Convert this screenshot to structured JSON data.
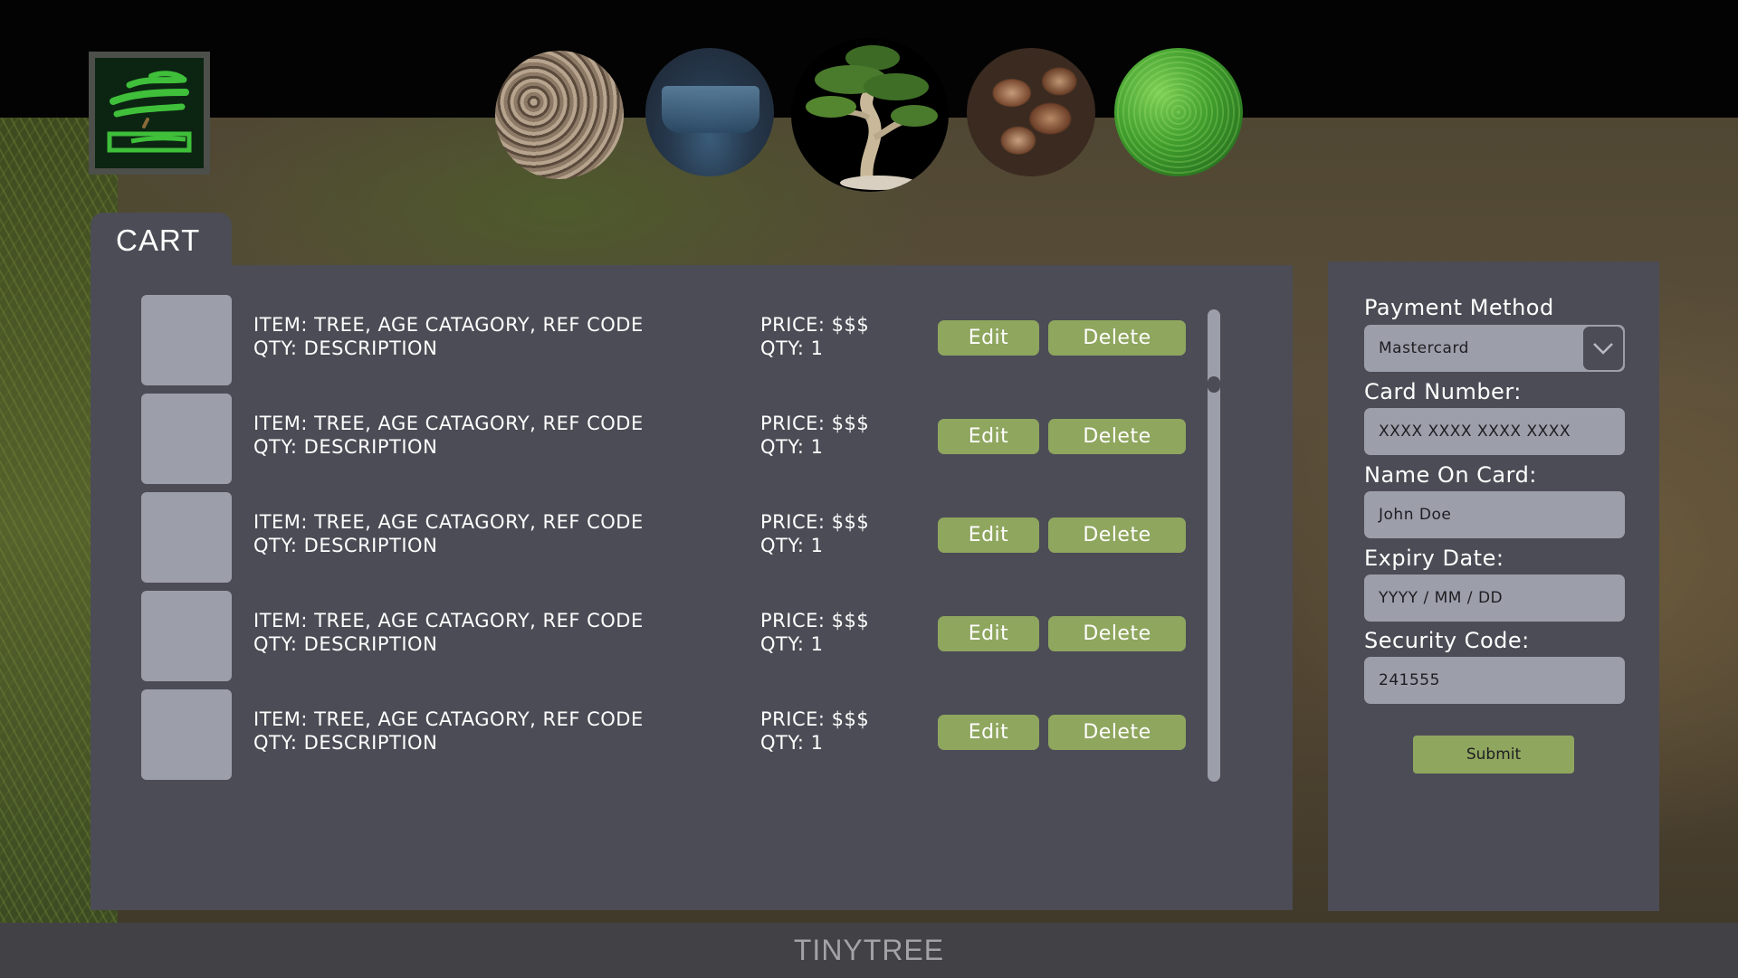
{
  "header": {
    "logo": "tinytree-logo",
    "categories": [
      {
        "name": "bark-mulch",
        "icon": "mulch-image"
      },
      {
        "name": "bonsai-pots",
        "icon": "pot-image"
      },
      {
        "name": "bonsai-trees",
        "icon": "tree-image"
      },
      {
        "name": "seeds",
        "icon": "seeds-image"
      },
      {
        "name": "moss",
        "icon": "moss-image"
      }
    ]
  },
  "cart": {
    "title": "CART",
    "items": [
      {
        "line1": "ITEM: TREE, AGE CATAGORY, REF CODE",
        "line2": "QTY: DESCRIPTION",
        "price": "PRICE: $$$",
        "qty": "QTY: 1",
        "edit": "Edit",
        "delete": "Delete"
      },
      {
        "line1": "ITEM: TREE, AGE CATAGORY, REF CODE",
        "line2": "QTY: DESCRIPTION",
        "price": "PRICE: $$$",
        "qty": "QTY: 1",
        "edit": "Edit",
        "delete": "Delete"
      },
      {
        "line1": "ITEM: TREE, AGE CATAGORY, REF CODE",
        "line2": "QTY: DESCRIPTION",
        "price": "PRICE: $$$",
        "qty": "QTY: 1",
        "edit": "Edit",
        "delete": "Delete"
      },
      {
        "line1": "ITEM: TREE, AGE CATAGORY, REF CODE",
        "line2": "QTY: DESCRIPTION",
        "price": "PRICE: $$$",
        "qty": "QTY: 1",
        "edit": "Edit",
        "delete": "Delete"
      },
      {
        "line1": "ITEM: TREE, AGE CATAGORY, REF CODE",
        "line2": "QTY: DESCRIPTION",
        "price": "PRICE: $$$",
        "qty": "QTY: 1",
        "edit": "Edit",
        "delete": "Delete"
      }
    ]
  },
  "payment": {
    "method_label": "Payment Method",
    "method_value": "Mastercard",
    "card_number_label": "Card Number:",
    "card_number_value": "XXXX XXXX XXXX XXXX",
    "name_label": "Name On Card:",
    "name_value": "John Doe",
    "expiry_label": "Expiry Date:",
    "expiry_value": "YYYY / MM / DD",
    "security_label": "Security Code:",
    "security_value": "241555",
    "submit_label": "Submit"
  },
  "footer": {
    "brand": "TINYTREE"
  },
  "colors": {
    "accent": "#8fa65e",
    "panel": "#4c4c56",
    "field": "#9c9eaa"
  }
}
